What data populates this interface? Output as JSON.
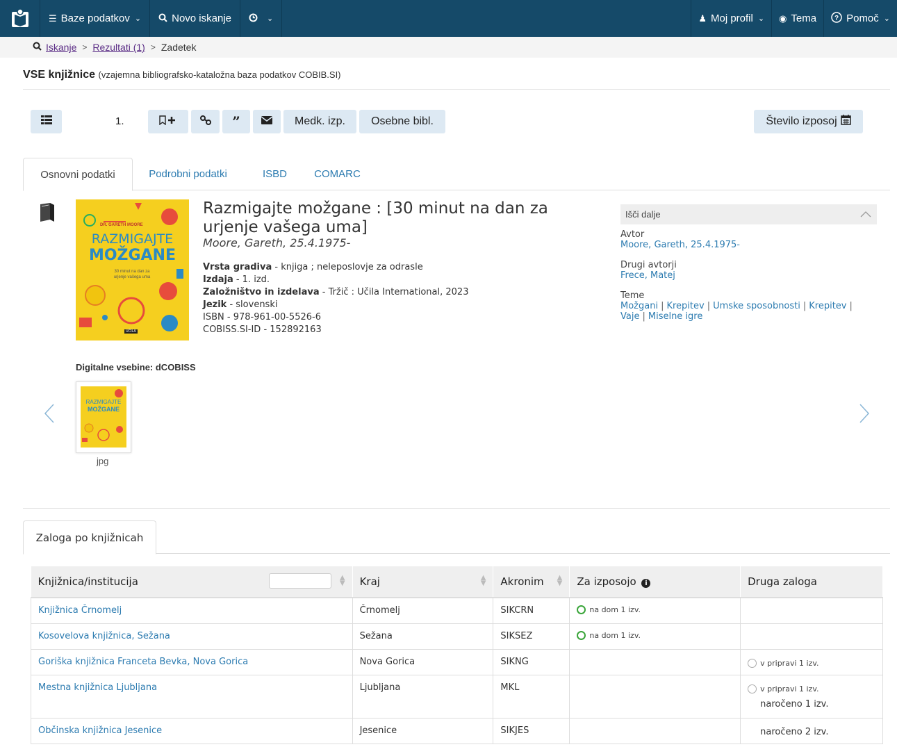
{
  "nav": {
    "databases": "Baze podatkov",
    "new_search": "Novo iskanje",
    "profile": "Moj profil",
    "theme": "Tema",
    "help": "Pomoč"
  },
  "breadcrumb": {
    "search": "Iskanje",
    "results": "Rezultati (1)",
    "current": "Zadetek"
  },
  "database": {
    "name": "VSE knjižnice",
    "description": "(vzajemna bibliografsko-kataložna baza podatkov COBIB.SI)"
  },
  "toolbar": {
    "record_number": "1.",
    "interlibrary_loan": "Medk. izp.",
    "personal_bibliography": "Osebne bibl.",
    "loan_count": "Število izposoj"
  },
  "tabs": [
    "Osnovni podatki",
    "Podrobni podatki",
    "ISBD",
    "COMARC"
  ],
  "cover": {
    "author": "DR. GARETH MOORE",
    "title_line1": "RAZMIGAJTE",
    "title_line2": "MOŽGANE",
    "subtitle": "30 minut na dan za urjenje vašega uma",
    "publisher": "UČILA"
  },
  "record": {
    "title": "Razmigajte možgane : [30 minut na dan za urjenje vašega uma]",
    "author": "Moore, Gareth, 25.4.1975-",
    "fields": [
      {
        "label": "Vrsta gradiva",
        "value": " - knjiga ; neleposlovje za odrasle"
      },
      {
        "label": "Izdaja",
        "value": " - 1. izd."
      },
      {
        "label": "Založništvo in izdelava",
        "value": " - Tržič : Učila International, 2023"
      },
      {
        "label": "Jezik",
        "value": " - slovenski"
      },
      {
        "label": "ISBN",
        "value": " - 978-961-00-5526-6"
      },
      {
        "label": "COBISS.SI-ID",
        "value": " - 152892163"
      }
    ]
  },
  "search_more": {
    "header": "Išči dalje",
    "author_label": "Avtor",
    "author": "Moore, Gareth, 25.4.1975-",
    "other_authors_label": "Drugi avtorji",
    "other_author": "Frece, Matej",
    "topics_label": "Teme",
    "topics": [
      "Možgani",
      "Krepitev",
      "Umske sposobnosti",
      "Krepitev",
      "Vaje",
      "Miselne igre"
    ]
  },
  "digital": {
    "label": "Digitalne vsebine: dCOBISS",
    "file_type": "jpg",
    "thumb_line1": "RAZMIGAJTE",
    "thumb_line2": "MOŽGANE"
  },
  "holdings": {
    "tab": "Zaloga po knjižnicah",
    "columns": [
      "Knjižnica/institucija",
      "Kraj",
      "Akronim",
      "Za izposojo",
      "Druga zaloga"
    ],
    "rows": [
      {
        "library": "Knjižnica Črnomelj",
        "city": "Črnomelj",
        "acronym": "SIKCRN",
        "available": "na dom 1 izv.",
        "other1": "",
        "other2": ""
      },
      {
        "library": "Kosovelova knjižnica, Sežana",
        "city": "Sežana",
        "acronym": "SIKSEZ",
        "available": "na dom 1 izv.",
        "other1": "",
        "other2": ""
      },
      {
        "library": "Goriška knjižnica Franceta Bevka, Nova Gorica",
        "city": "Nova Gorica",
        "acronym": "SIKNG",
        "available": "",
        "other1": "v pripravi 1 izv.",
        "other2": ""
      },
      {
        "library": "Mestna knjižnica Ljubljana",
        "city": "Ljubljana",
        "acronym": "MKL",
        "available": "",
        "other1": "v pripravi 1 izv.",
        "other2": "naročeno 1 izv."
      },
      {
        "library": "Občinska knjižnica Jesenice",
        "city": "Jesenice",
        "acronym": "SIKJES",
        "available": "",
        "other1": "",
        "other2": "naročeno 2 izv."
      }
    ]
  },
  "colors": {
    "navbar": "#154a69",
    "link": "#2c7bb0",
    "button_bg": "#dde9f3",
    "available": "#3aa53a"
  }
}
